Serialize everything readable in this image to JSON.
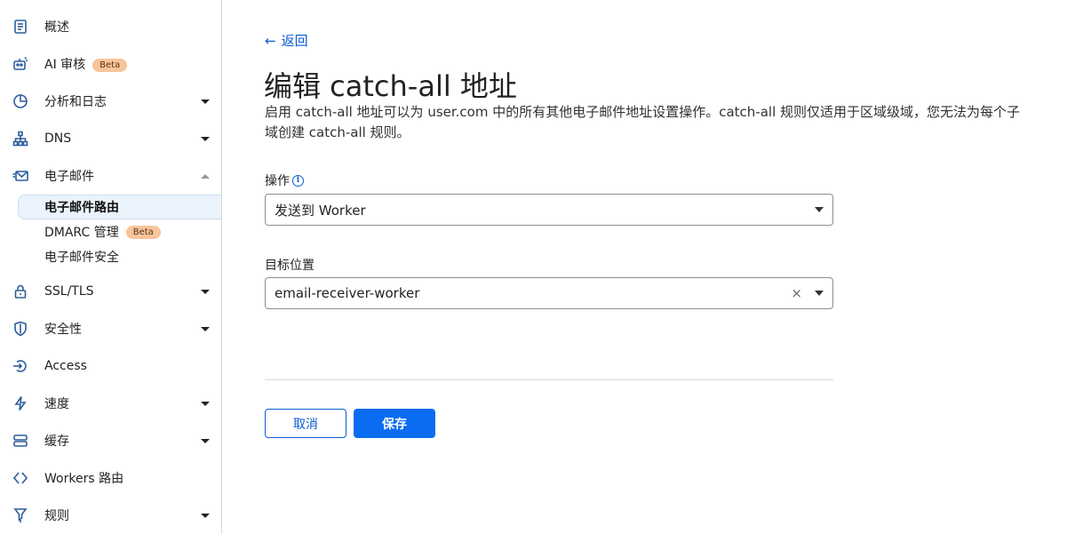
{
  "sidebar": {
    "items": [
      {
        "label": "概述",
        "icon": "document-icon",
        "caret": "none"
      },
      {
        "label": "AI 审核",
        "icon": "robot-icon",
        "badge": "Beta",
        "caret": "none"
      },
      {
        "label": "分析和日志",
        "icon": "chart-pie-icon",
        "caret": "down"
      },
      {
        "label": "DNS",
        "icon": "network-icon",
        "caret": "down"
      },
      {
        "label": "电子邮件",
        "icon": "email-icon",
        "caret": "up"
      },
      {
        "label": "SSL/TLS",
        "icon": "lock-icon",
        "caret": "down"
      },
      {
        "label": "安全性",
        "icon": "shield-icon",
        "caret": "down"
      },
      {
        "label": "Access",
        "icon": "access-icon",
        "caret": "none"
      },
      {
        "label": "速度",
        "icon": "lightning-icon",
        "caret": "down"
      },
      {
        "label": "缓存",
        "icon": "storage-icon",
        "caret": "down"
      },
      {
        "label": "Workers 路由",
        "icon": "code-icon",
        "caret": "none"
      },
      {
        "label": "规则",
        "icon": "rules-icon",
        "caret": "down"
      }
    ],
    "email_sub": [
      {
        "label": "电子邮件路由",
        "active": true
      },
      {
        "label": "DMARC 管理",
        "badge": "Beta"
      },
      {
        "label": "电子邮件安全"
      }
    ]
  },
  "main": {
    "back_label": "返回",
    "title": "编辑 catch-all 地址",
    "description": "启用 catch-all 地址可以为 user.com 中的所有其他电子邮件地址设置操作。catch-all 规则仅适用于区域级域，您无法为每个子域创建 catch-all 规则。",
    "action_label": "操作",
    "action_value": "发送到 Worker",
    "destination_label": "目标位置",
    "destination_value": "email-receiver-worker",
    "cancel_label": "取消",
    "save_label": "保存"
  },
  "colors": {
    "accent": "#0a6cf0",
    "link": "#0a5bd3",
    "badge_bg": "#f8c49b",
    "active_bg": "#ebf3fc"
  }
}
